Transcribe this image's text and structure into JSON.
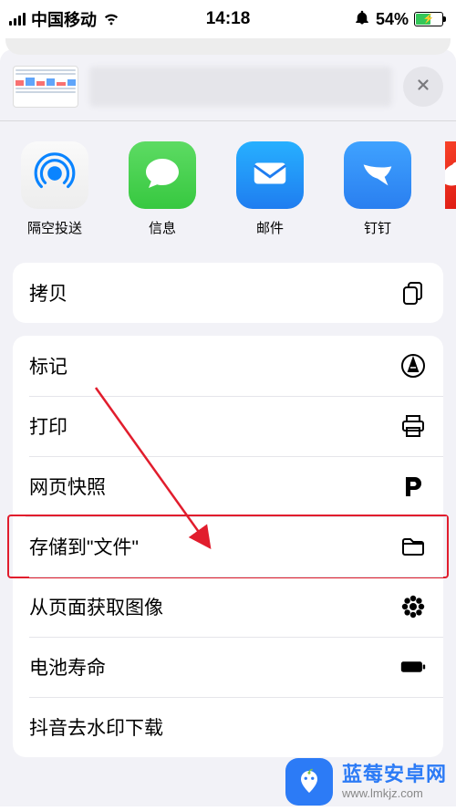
{
  "status": {
    "carrier": "中国移动",
    "time": "14:18",
    "battery_pct": "54%"
  },
  "apps": [
    {
      "label": "隔空投送",
      "name": "airdrop"
    },
    {
      "label": "信息",
      "name": "messages"
    },
    {
      "label": "邮件",
      "name": "mail"
    },
    {
      "label": "钉钉",
      "name": "dingtalk"
    }
  ],
  "actions": {
    "copy": "拷贝",
    "markup": "标记",
    "print": "打印",
    "webarchive": "网页快照",
    "save_to_files": "存储到\"文件\"",
    "get_images": "从页面获取图像",
    "battery_life": "电池寿命",
    "douyin": "抖音去水印下载"
  },
  "watermark": {
    "title": "蓝莓安卓网",
    "url": "www.lmkjz.com"
  }
}
